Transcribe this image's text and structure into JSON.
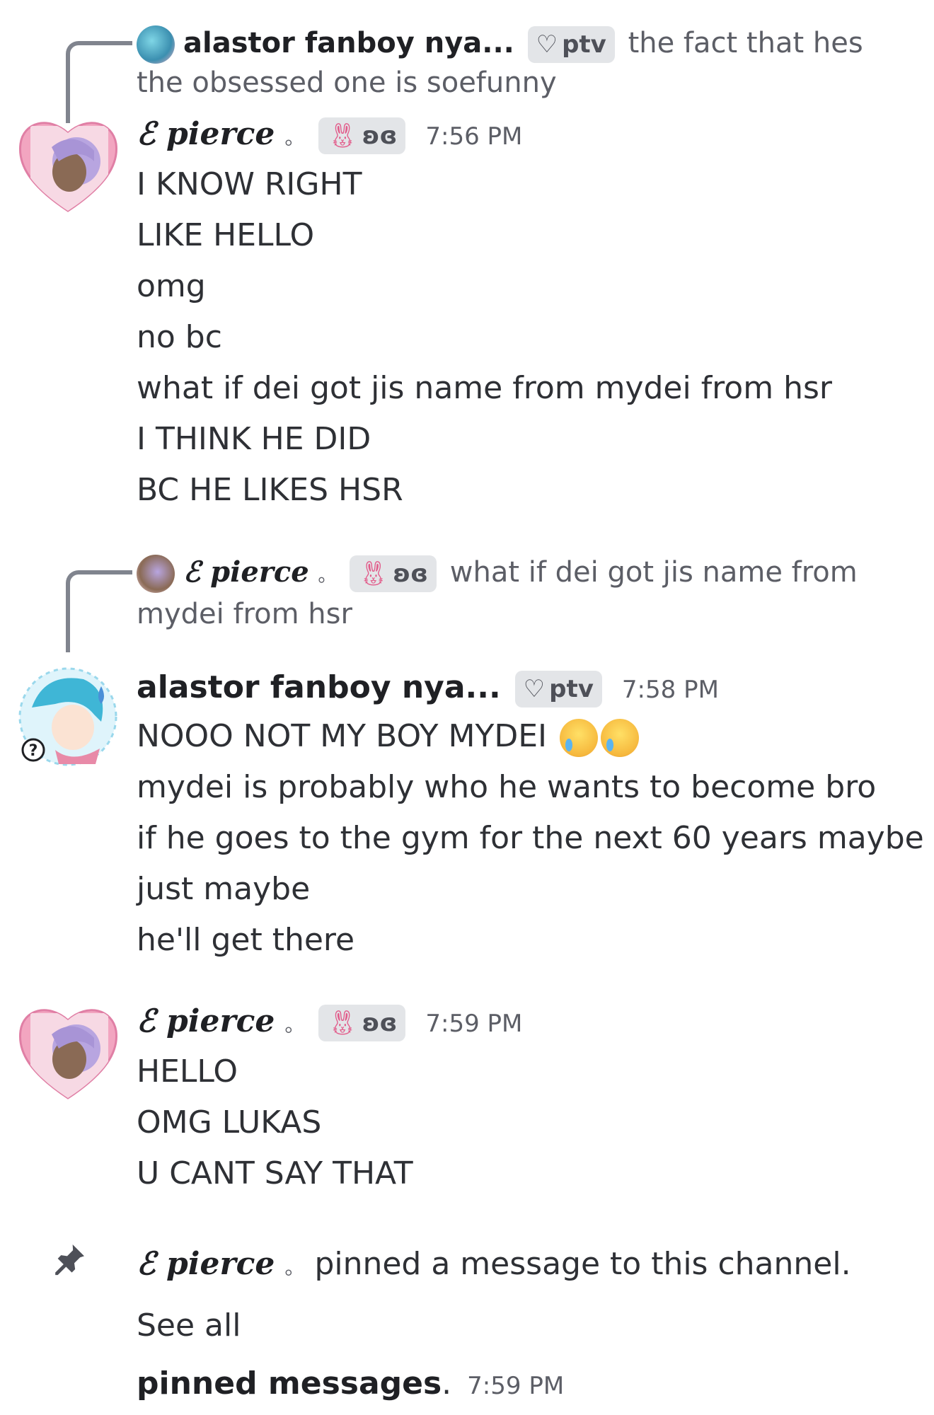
{
  "messages": [
    {
      "reply": {
        "author": "alastor fanboy nya...",
        "tag": "ptv",
        "text": "the fact that hes the obsessed one is soefunny"
      },
      "author": "pierce",
      "author_suffix": "。",
      "tag": "ʚɞ",
      "time": "7:56 PM",
      "lines": [
        "I KNOW RIGHT",
        "LIKE HELLO",
        "omg",
        "no bc",
        "what if dei got jis name from mydei from hsr",
        "I THINK HE DID",
        "BC HE LIKES HSR"
      ]
    },
    {
      "reply": {
        "author": "pierce",
        "author_suffix": "。",
        "tag": "ʚɞ",
        "text": "what if dei got jis name from mydei from hsr"
      },
      "author": "alastor fanboy nya...",
      "tag": "ptv",
      "time": "7:58 PM",
      "lines": [
        "NOOO NOT MY BOY MYDEI",
        "mydei is probably who he wants to become bro",
        "if he goes to the gym for the next 60 years maybe",
        "just maybe",
        "he'll get there"
      ]
    },
    {
      "author": "pierce",
      "author_suffix": "。",
      "tag": "ʚɞ",
      "time": "7:59 PM",
      "lines": [
        "HELLO",
        "OMG LUKAS",
        "U CANT SAY THAT"
      ]
    }
  ],
  "system": {
    "author": "pierce",
    "author_suffix": "。",
    "text": "pinned a message to this channel. See all",
    "link": "pinned messages",
    "time": "7:59 PM"
  },
  "colors": {
    "heart": "#f2a5c0",
    "tag_bg": "#e3e5e8",
    "muted": "#5c5e66"
  }
}
